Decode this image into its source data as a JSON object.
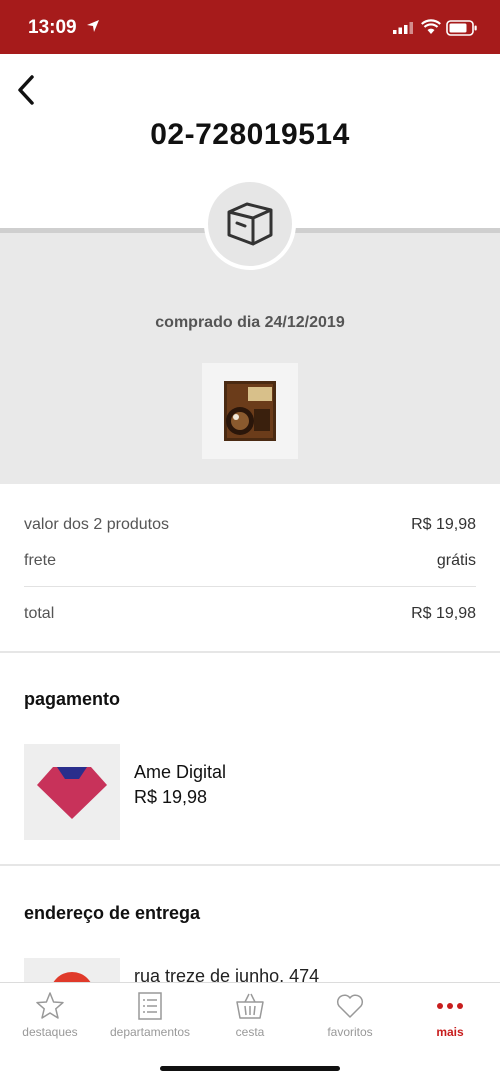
{
  "status_bar": {
    "time": "13:09"
  },
  "order": {
    "number": "02-728019514",
    "purchase_date": "comprado dia 24/12/2019"
  },
  "summary": {
    "products_label": "valor dos 2 produtos",
    "products_value": "R$ 19,98",
    "shipping_label": "frete",
    "shipping_value": "grátis",
    "total_label": "total",
    "total_value": "R$ 19,98"
  },
  "payment": {
    "title": "pagamento",
    "method": "Ame Digital",
    "amount": "R$ 19,98"
  },
  "delivery": {
    "title": "endereço de entrega",
    "address_partial": "rua treze de junho, 474"
  },
  "tabs": [
    {
      "label": "destaques",
      "icon": "star-icon",
      "active": false
    },
    {
      "label": "departamentos",
      "icon": "list-icon",
      "active": false
    },
    {
      "label": "cesta",
      "icon": "basket-icon",
      "active": false
    },
    {
      "label": "favoritos",
      "icon": "heart-icon",
      "active": false
    },
    {
      "label": "mais",
      "icon": "more-dots-icon",
      "active": true
    }
  ],
  "colors": {
    "brand": "#a61b1b",
    "active_tab": "#c81e1e",
    "ame": "#c8325a"
  }
}
